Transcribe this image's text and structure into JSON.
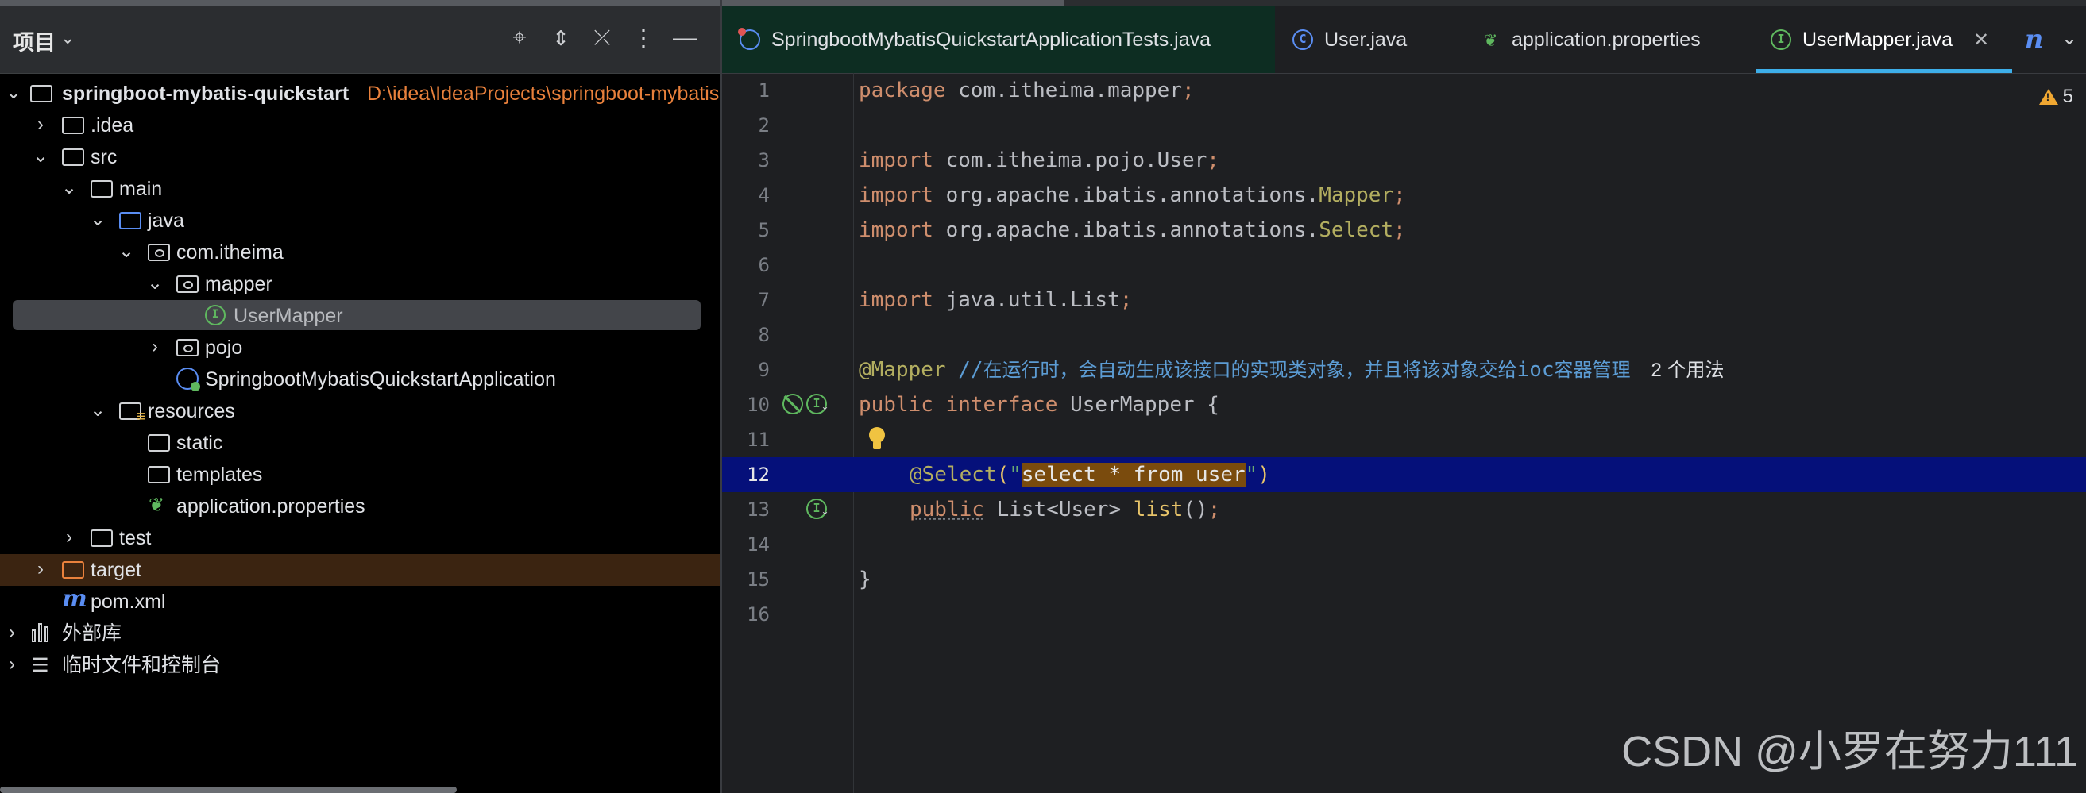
{
  "project_panel": {
    "title": "项目",
    "tree": [
      {
        "label": "springboot-mybatis-quickstart",
        "path": "D:\\idea\\IdeaProjects\\springboot-mybatis-quickstart"
      },
      {
        "label": ".idea"
      },
      {
        "label": "src"
      },
      {
        "label": "main"
      },
      {
        "label": "java"
      },
      {
        "label": "com.itheima"
      },
      {
        "label": "mapper"
      },
      {
        "label": "UserMapper"
      },
      {
        "label": "pojo"
      },
      {
        "label": "SpringbootMybatisQuickstartApplication"
      },
      {
        "label": "resources"
      },
      {
        "label": "static"
      },
      {
        "label": "templates"
      },
      {
        "label": "application.properties"
      },
      {
        "label": "test"
      },
      {
        "label": "target"
      },
      {
        "label": "pom.xml"
      },
      {
        "label": "外部库"
      },
      {
        "label": "临时文件和控制台"
      }
    ]
  },
  "editor": {
    "tabs": [
      {
        "label": "SpringbootMybatisQuickstartApplicationTests.java"
      },
      {
        "label": "User.java"
      },
      {
        "label": "application.properties"
      },
      {
        "label": "UserMapper.java"
      }
    ],
    "warning_count": "5",
    "line_numbers": [
      "1",
      "2",
      "3",
      "4",
      "5",
      "6",
      "7",
      "8",
      "9",
      "10",
      "11",
      "12",
      "13",
      "14",
      "15",
      "16"
    ],
    "code": {
      "l1_kw": "package",
      "l1_pkg": " com.itheima.mapper",
      "l3_kw": "import",
      "l3_rest": " com.itheima.pojo.User",
      "l4_kw": "import",
      "l4_rest": " org.apache.ibatis.annotations.",
      "l4_ann": "Mapper",
      "l5_kw": "import",
      "l5_rest": " org.apache.ibatis.annotations.",
      "l5_ann": "Select",
      "l7_kw": "import",
      "l7_rest": " java.util.List",
      "l9_ann": "@Mapper",
      "l9_slash": " //",
      "l9_comment_a": "在运行时，会自动生成该接口的实现类对象，并且将该对象交给",
      "l9_comment_ioc": "ioc",
      "l9_comment_b": "容器管理",
      "l9_usages": "2 个用法",
      "l10_kw": "public interface",
      "l10_name": " UserMapper {",
      "l12_ann": "@Select",
      "l12_paren_open": "(",
      "l12_quote_open": "\"",
      "l12_sql": "select * from user",
      "l12_quote_close": "\"",
      "l12_paren_close": ")",
      "l13_kw": "public",
      "l13_type": " List<User> ",
      "l13_fn": "list",
      "l13_end": "()",
      "l15_brace": "}",
      "semicolon": ";"
    }
  },
  "watermark": "CSDN @小罗在努力111"
}
